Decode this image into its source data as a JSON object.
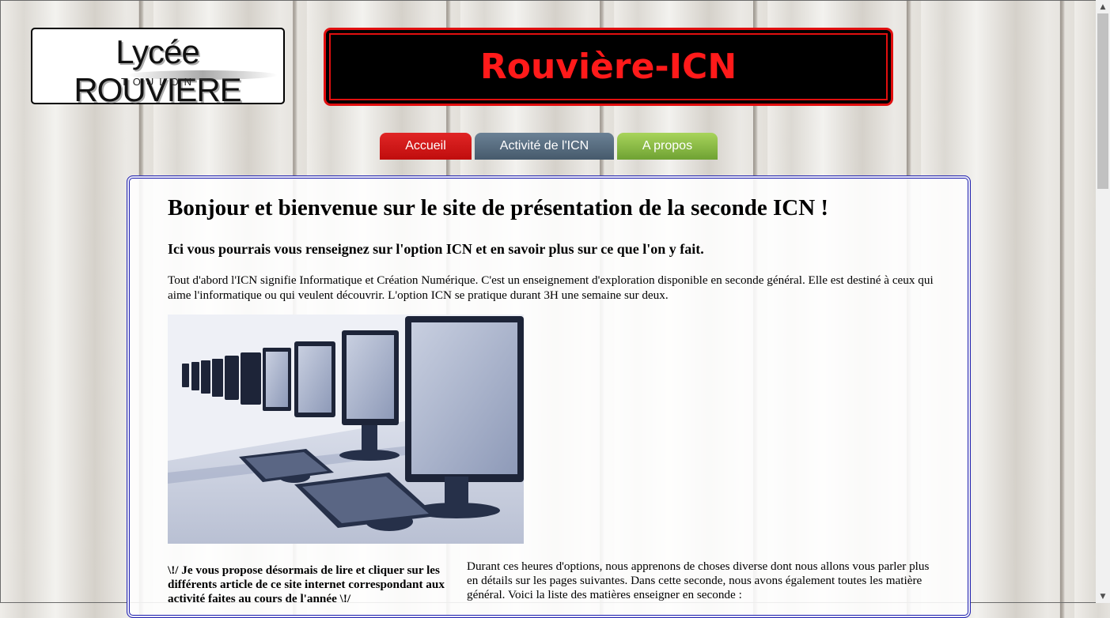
{
  "header": {
    "logo_main": "Lycée ROUVIERE",
    "logo_sub": "TOULON",
    "site_title": "Rouvière-ICN"
  },
  "nav": {
    "tabs": [
      {
        "label": "Accueil",
        "color": "#d21a1a"
      },
      {
        "label": "Activité de l'ICN",
        "color": "#56697b"
      },
      {
        "label": "A propos",
        "color": "#8dbf45"
      }
    ]
  },
  "main": {
    "heading": "Bonjour et bienvenue sur le site de présentation de la seconde ICN !",
    "subheading": "Ici vous pourrais vous renseignez sur l'option ICN et en savoir plus sur ce que l'on y fait.",
    "intro": "Tout d'abord l'ICN signifie Informatique et Création Numérique. C'est un enseignement d'exploration disponible en seconde général. Elle est destiné à ceux qui aime l'informatique ou qui veulent découvrir. L'option ICN se pratique durant 3H une semaine sur deux.",
    "image_icon": "computer-lab-photo-icon",
    "note": "\\!/ Je vous propose désormais de lire et cliquer sur les différents article de ce site internet correspondant aux activité faites au cours de l'année \\!/",
    "body": "Durant ces heures d'options, nous apprenons de choses diverse dont nous allons vous parler plus en détails sur les pages suivantes. Dans cette seconde, nous avons également toutes les matière général. Voici la liste des matières enseigner en seconde :"
  },
  "scrollbar": {
    "up_icon": "scroll-up-arrow-icon",
    "down_icon": "scroll-down-arrow-icon"
  }
}
